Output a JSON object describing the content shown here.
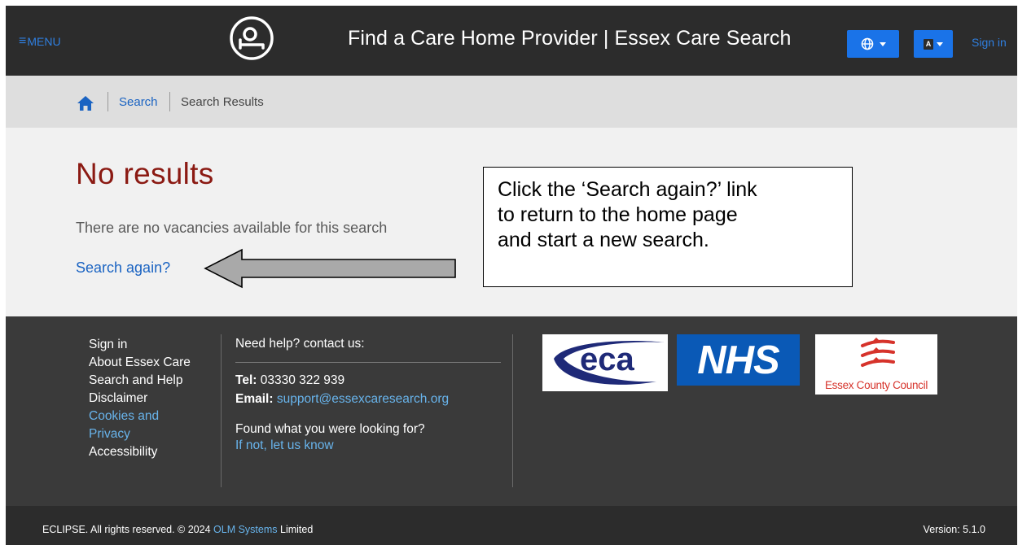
{
  "header": {
    "menu_label": "MENU",
    "site_title": "Find a Care Home Provider | Essex Care Search",
    "sign_in": "Sign in",
    "text_size_badge": "A"
  },
  "breadcrumb": {
    "search": "Search",
    "current": "Search Results"
  },
  "main": {
    "heading": "No results",
    "message": "There are no vacancies available for this search",
    "search_again": "Search again?"
  },
  "callout": {
    "lines": [
      "Click the ‘Search again?’ link",
      "to return to the home page",
      "and start a new search."
    ]
  },
  "footer": {
    "links": [
      "Sign in",
      "About Essex Care",
      "Search and Help",
      "Disclaimer",
      "Cookies and",
      "Privacy",
      "Accessibility"
    ],
    "help_heading": "Need help? contact us:",
    "tel_label": "Tel:",
    "tel_value": "03330 322 939",
    "email_label": "Email:",
    "email_value": "support@essexcaresearch.org",
    "found_text": "Found what you were looking for?",
    "let_us_know": "If not, let us know",
    "logos": {
      "eca": "eca",
      "nhs": "NHS",
      "ecc": "Essex County Council"
    }
  },
  "bottom": {
    "copyright_prefix": "ECLIPSE. All rights reserved. © 2024 ",
    "copyright_link": "OLM Systems",
    "copyright_suffix": " Limited",
    "version": "Version: 5.1.0"
  },
  "colors": {
    "header_bg": "#2c2c2c",
    "accent_blue": "#1a73e8",
    "link_blue": "#1a63c2",
    "heading_red": "#8b1a13",
    "footer_bg": "#3a3a3a",
    "nhs_blue": "#0a59b6",
    "ecc_red": "#d6332b"
  },
  "icons": [
    "menu-icon",
    "care-home-logo-icon",
    "globe-icon",
    "home-icon",
    "left-arrow-icon"
  ]
}
